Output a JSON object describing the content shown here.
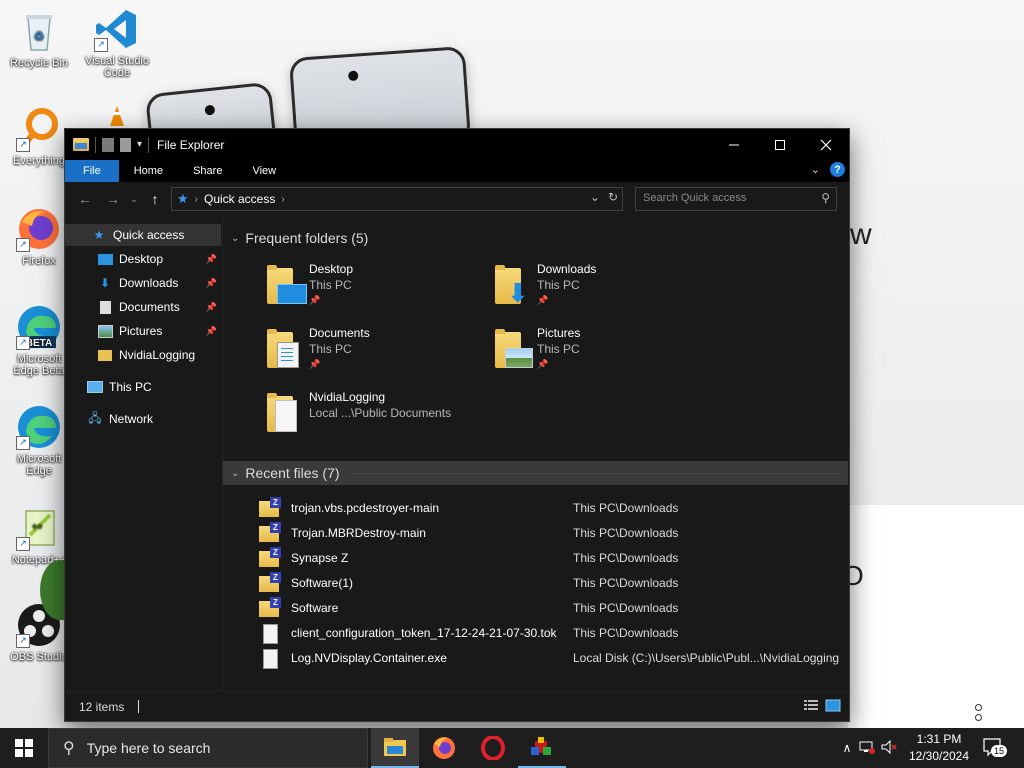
{
  "desktop": {
    "wallpaper_text_1": "w",
    "wallpaper_text_2": "O",
    "icons": [
      {
        "label": "Recycle Bin",
        "icon": "recycle-bin-icon"
      },
      {
        "label": "Visual Studio Code",
        "icon": "vscode-icon"
      },
      {
        "label": "Everything",
        "icon": "everything-search-icon"
      },
      {
        "label": "Firefox",
        "icon": "firefox-icon"
      },
      {
        "label": "Microsoft Edge Beta",
        "icon": "edge-beta-icon"
      },
      {
        "label": "Microsoft Edge",
        "icon": "edge-icon"
      },
      {
        "label": "Notepad++",
        "icon": "notepad-plus-plus-icon"
      },
      {
        "label": "OBS Studio",
        "icon": "obs-studio-icon"
      }
    ]
  },
  "explorer": {
    "title": "File Explorer",
    "ribbon_tabs": [
      "File",
      "Home",
      "Share",
      "View"
    ],
    "address": {
      "crumb": "Quick access"
    },
    "search": {
      "placeholder": "Search Quick access"
    },
    "nav_pane": {
      "items": [
        {
          "label": "Quick access",
          "icon": "star-icon",
          "selected": true
        },
        {
          "label": "Desktop",
          "icon": "desktop-folder-icon",
          "pinned": true
        },
        {
          "label": "Downloads",
          "icon": "download-arrow-icon",
          "pinned": true
        },
        {
          "label": "Documents",
          "icon": "documents-icon",
          "pinned": true
        },
        {
          "label": "Pictures",
          "icon": "pictures-icon",
          "pinned": true
        },
        {
          "label": "NvidiaLogging",
          "icon": "folder-icon"
        },
        {
          "label": "This PC",
          "icon": "computer-icon"
        },
        {
          "label": "Network",
          "icon": "network-icon"
        }
      ]
    },
    "frequent": {
      "header": "Frequent folders (5)",
      "folders": [
        {
          "name": "Desktop",
          "location": "This PC",
          "pinned": true
        },
        {
          "name": "Downloads",
          "location": "This PC",
          "pinned": true
        },
        {
          "name": "Documents",
          "location": "This PC",
          "pinned": true
        },
        {
          "name": "Pictures",
          "location": "This PC",
          "pinned": true
        },
        {
          "name": "NvidiaLogging",
          "location": "Local ...\\Public Documents",
          "pinned": false
        }
      ]
    },
    "recent": {
      "header": "Recent files (7)",
      "files": [
        {
          "name": "trojan.vbs.pcdestroyer-main",
          "path": "This PC\\Downloads",
          "type": "zip"
        },
        {
          "name": "Trojan.MBRDestroy-main",
          "path": "This PC\\Downloads",
          "type": "zip"
        },
        {
          "name": "Synapse Z",
          "path": "This PC\\Downloads",
          "type": "zip"
        },
        {
          "name": "Software(1)",
          "path": "This PC\\Downloads",
          "type": "zip"
        },
        {
          "name": "Software",
          "path": "This PC\\Downloads",
          "type": "zip"
        },
        {
          "name": "client_configuration_token_17-12-24-21-07-30.tok",
          "path": "This PC\\Downloads",
          "type": "file"
        },
        {
          "name": "Log.NVDisplay.Container.exe",
          "path": "Local Disk (C:)\\Users\\Public\\Publ...\\NvidiaLogging",
          "type": "file"
        }
      ]
    },
    "status": {
      "item_count": "12 items"
    }
  },
  "taskbar": {
    "search_placeholder": "Type here to search",
    "apps": [
      "file-explorer-icon",
      "firefox-icon",
      "opera-icon",
      "paint-icon"
    ],
    "clock": {
      "time": "1:31 PM",
      "date": "12/30/2024"
    },
    "notifications": "15"
  },
  "colors": {
    "accent": "#1a6fc6",
    "window_bg": "#191919",
    "titlebar_bg": "#000000",
    "taskbar_bg": "#1e1e1e"
  }
}
